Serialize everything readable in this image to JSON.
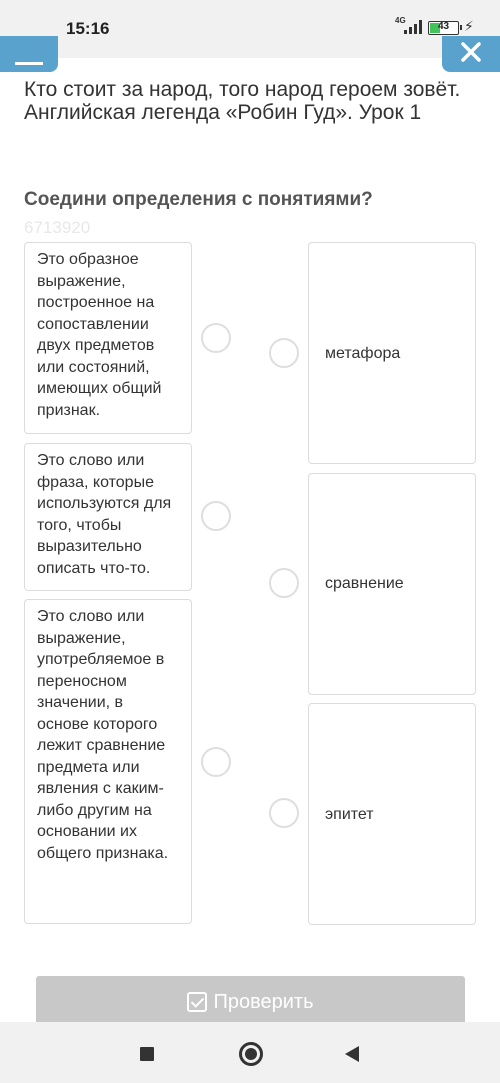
{
  "status": {
    "time": "15:16",
    "network": "4G",
    "battery": "43",
    "battery_level": 0.43
  },
  "header": {
    "title": "Кто стоит за народ, того народ героем зовёт. Английская легенда «Робин Гуд». Урок 1"
  },
  "task": {
    "title": "Соедини определения с понятиями?",
    "id": "6713920"
  },
  "definitions": [
    {
      "text": "Это образное выражение, построенное на сопоставлении двух предметов или состояний, имеющих общий признак."
    },
    {
      "text": "Это слово или фраза, которые используются для того, чтобы выразительно описать что-то."
    },
    {
      "text": "Это слово или выражение, употребляемое в переносном значении, в основе которого лежит сравнение предмета или явления с каким-либо другим на основании их общего признака."
    }
  ],
  "concepts": [
    {
      "text": "метафора"
    },
    {
      "text": "сравнение"
    },
    {
      "text": "эпитет"
    }
  ],
  "actions": {
    "check_label": "Проверить"
  },
  "icons": {
    "menu": "hamburger-icon",
    "close": "close-icon",
    "check": "checkbox-icon",
    "nav_recent": "square-icon",
    "nav_home": "circle-icon",
    "nav_back": "triangle-back-icon"
  },
  "colors": {
    "accent": "#5aa2ce",
    "button_disabled": "#c8c8c8",
    "battery": "#43c45a"
  }
}
